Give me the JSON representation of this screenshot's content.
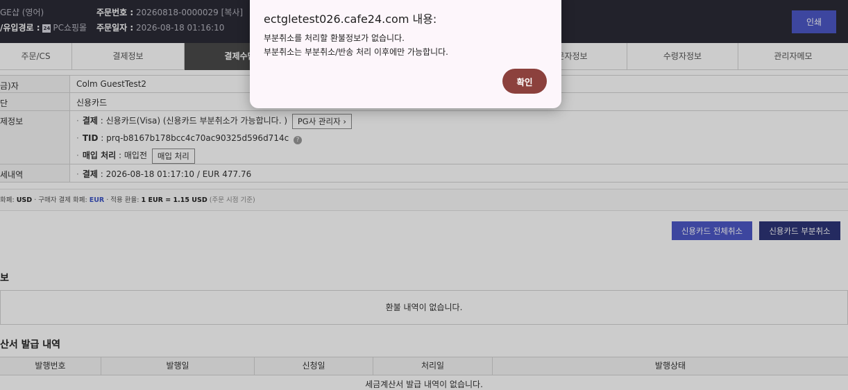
{
  "header": {
    "shop": "GE샵 (영어)",
    "channel_label": "/유입경로 :",
    "channel_badge": "24",
    "channel_value": "PC쇼핑몰",
    "order_no_label": "주문번호 :",
    "order_no_value": "20260818-0000029 [복사]",
    "order_date_label": "주문일자 :",
    "order_date_value": "2026-08-18 01:16:10",
    "print_button": "인쇄"
  },
  "tabs": [
    {
      "label": "주문/CS"
    },
    {
      "label": "결제정보"
    },
    {
      "label": "결제수단"
    },
    {
      "label": ""
    },
    {
      "label": ""
    },
    {
      "label": "문자정보"
    },
    {
      "label": "수령자정보"
    },
    {
      "label": "관리자메모"
    }
  ],
  "info": {
    "payer_label": "금)자",
    "payer_value": "Colm GuestTest2",
    "method_label": "단",
    "method_value": "신용카드",
    "detail_label": "제정보",
    "payment_key": "결제",
    "payment_value": ": 신용카드(Visa) (신용카드 부분취소가 가능합니다. )",
    "pg_button": "PG사 관리자 ›",
    "tid_key": "TID",
    "tid_value": ": prq-b8167b178bcc4c70ac90325d596d714c",
    "tid_help": "?",
    "purchase_key": "매입 처리",
    "purchase_value": ": 매입전",
    "purchase_button": "매입 처리",
    "history_label": "세내역",
    "history_key": "결제",
    "history_value": ": 2026-08-18 01:17:10 / EUR 477.76"
  },
  "currency": {
    "base_label": "화폐:",
    "base_value": "USD",
    "buyer_label": "· 구매자 결제 화폐:",
    "buyer_value": "EUR",
    "rate_label": "· 적용 환율:",
    "rate_value": "1 EUR = 1.15 USD",
    "rate_note": "(주문 시점 기준)"
  },
  "actions": {
    "full_cancel": "신용카드 전체취소",
    "partial_cancel": "신용카드 부분취소"
  },
  "refund": {
    "title": "보",
    "empty": "환불 내역이 없습니다."
  },
  "tax": {
    "title": "산서 발급 내역",
    "columns": [
      "발행번호",
      "발행일",
      "신청일",
      "처리일",
      "발행상태"
    ],
    "empty": "세금계산서 발급 내역이 없습니다."
  },
  "dialog": {
    "title": "ectgletest026.cafe24.com 내용:",
    "line1": "부분취소를 처리할 환불정보가 없습니다.",
    "line2": "부분취소는 부분취소/반송 처리 이후에만 가능합니다.",
    "ok": "확인"
  }
}
